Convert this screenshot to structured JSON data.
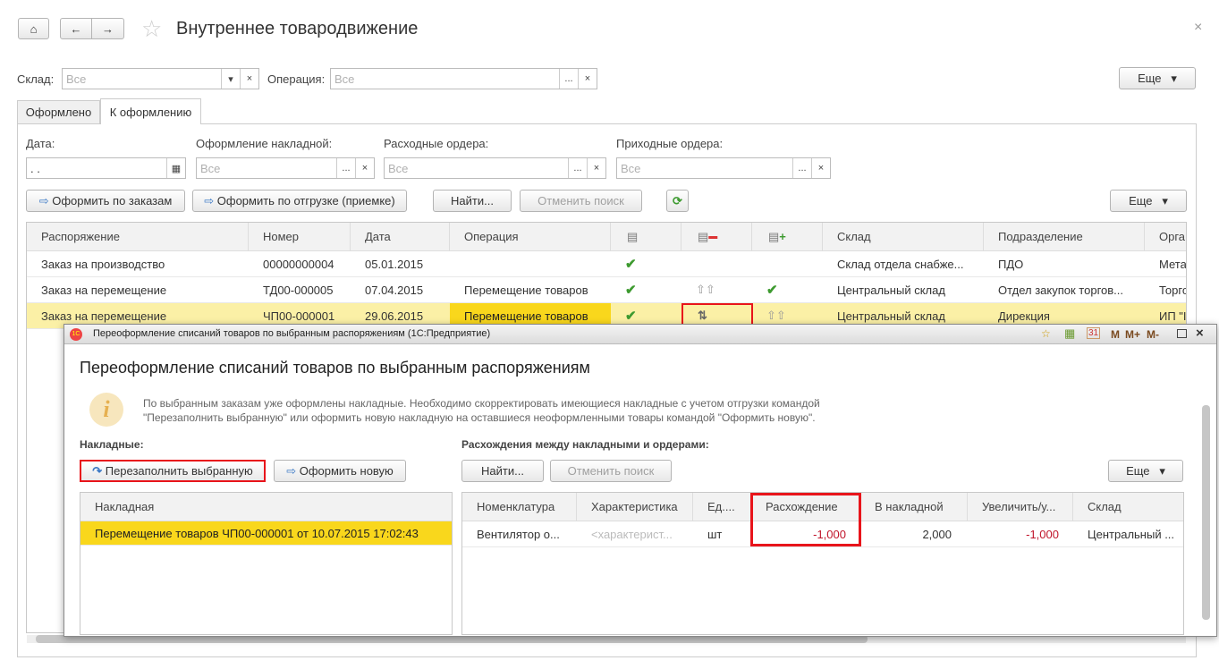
{
  "header": {
    "title": "Внутреннее товародвижение",
    "close": "×"
  },
  "filters": {
    "warehouse_label": "Склад:",
    "warehouse_placeholder": "Все",
    "operation_label": "Операция:",
    "operation_placeholder": "Все",
    "more": "Еще"
  },
  "tabs": [
    {
      "label": "Оформлено"
    },
    {
      "label": "К оформлению"
    }
  ],
  "form": {
    "date_label": "Дата:",
    "date_value": " .  .",
    "invoice_label": "Оформление накладной:",
    "invoice_placeholder": "Все",
    "expense_label": "Расходные ордера:",
    "expense_placeholder": "Все",
    "income_label": "Приходные ордера:",
    "income_placeholder": "Все"
  },
  "toolbar": {
    "by_orders": "Оформить по заказам",
    "by_shipment": "Оформить по отгрузке (приемке)",
    "find": "Найти...",
    "cancel_search": "Отменить поиск",
    "more": "Еще"
  },
  "table": {
    "columns": [
      "Распоряжение",
      "Номер",
      "Дата",
      "Операция",
      "",
      "",
      "",
      "Склад",
      "Подразделение",
      "Орга"
    ],
    "rows": [
      {
        "order": "Заказ на производство",
        "number": "00000000004",
        "date": "05.01.2015",
        "operation": "",
        "c1": "✔",
        "c2": "",
        "c3": "",
        "warehouse": "Склад отдела снабже...",
        "dept": "ПДО",
        "org": "Мета"
      },
      {
        "order": "Заказ на перемещение",
        "number": "ТД00-000005",
        "date": "07.04.2015",
        "operation": "Перемещение товаров",
        "c1": "✔",
        "c2": "⇧⇧",
        "c3": "✔",
        "warehouse": "Центральный склад",
        "dept": "Отдел закупок торгов...",
        "org": "Торго"
      },
      {
        "order": "Заказ на перемещение",
        "number": "ЧП00-000001",
        "date": "29.06.2015",
        "operation": "Перемещение товаров",
        "c1": "✔",
        "c2": "⇅",
        "c3": "⇧⇧",
        "warehouse": "Центральный склад",
        "dept": "Дирекция",
        "org": "ИП \"I"
      }
    ]
  },
  "dialog": {
    "window_title": "Переоформление списаний товаров по выбранным распоряжениям  (1С:Предприятие)",
    "title_icons": [
      "M",
      "M+",
      "M-"
    ],
    "heading": "Переоформление списаний товаров по выбранным распоряжениям",
    "info_line1": "По выбранным заказам уже оформлены накладные. Необходимо скорректировать имеющиеся накладные с учетом отгрузки командой",
    "info_line2": "\"Перезаполнить выбранную\" или оформить новую накладную на оставшиеся неоформленными товары  командой \"Оформить новую\".",
    "invoices_label": "Накладные:",
    "refill": "Перезаполнить выбранную",
    "create_new": "Оформить новую",
    "invoices_column": "Накладная",
    "invoice_row": "Перемещение товаров ЧП00-000001 от 10.07.2015 17:02:43",
    "diff_label": "Расхождения между накладными и ордерами:",
    "find": "Найти...",
    "cancel_search": "Отменить поиск",
    "more": "Еще",
    "diff_columns": [
      "Номенклатура",
      "Характеристика",
      "Ед....",
      "Расхождение",
      "В накладной",
      "Увеличить/у...",
      "Склад"
    ],
    "diff_row": {
      "item": "Вентилятор о...",
      "char": "<характерист...",
      "unit": "шт",
      "diff": "-1,000",
      "in_invoice": "2,000",
      "change": "-1,000",
      "warehouse": "Центральный ..."
    }
  }
}
